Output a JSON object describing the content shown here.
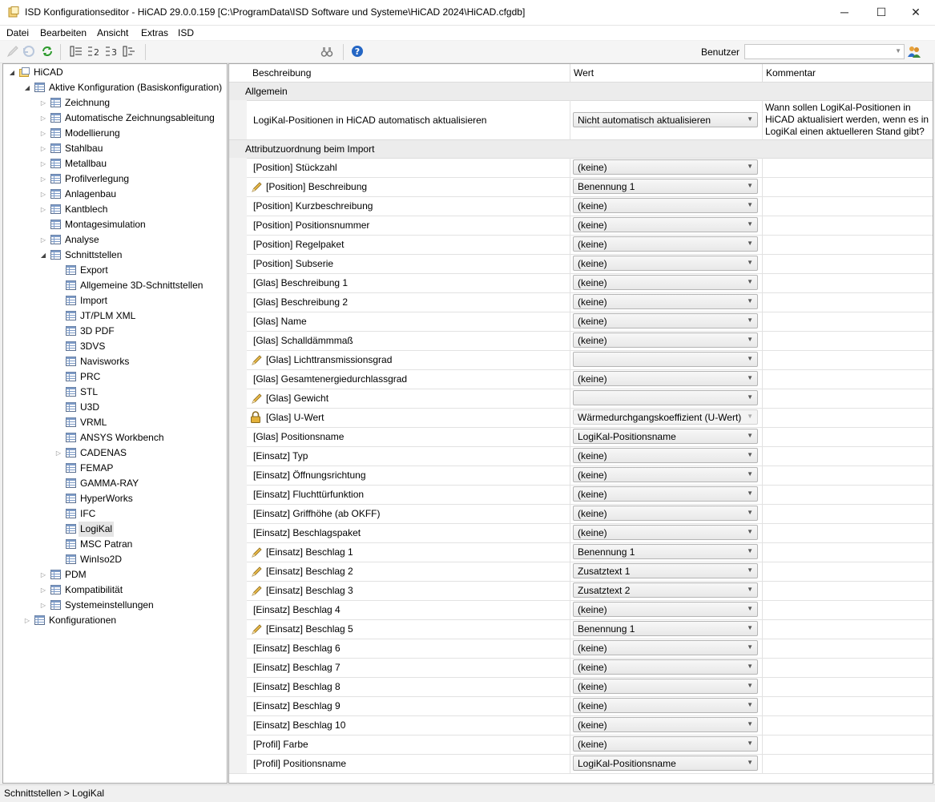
{
  "window": {
    "title": "ISD Konfigurationseditor  -  HiCAD 29.0.0.159 [C:\\ProgramData\\ISD Software und Systeme\\HiCAD 2024\\HiCAD.cfgdb]",
    "minimize": "─",
    "maximize": "☐",
    "close": "✕"
  },
  "menu": [
    "Datei",
    "Bearbeiten",
    "Ansicht",
    "Extras",
    "ISD"
  ],
  "toolbar": {
    "user_label": "Benutzer",
    "user_value": ""
  },
  "tree": [
    {
      "label": "HiCAD",
      "level": 0,
      "expander": "open",
      "icon": "folder-icon"
    },
    {
      "label": "Aktive Konfiguration (Basiskonfiguration)",
      "level": 1,
      "expander": "open",
      "icon": "grid-icon"
    },
    {
      "label": "Zeichnung",
      "level": 2,
      "expander": "closed",
      "icon": "grid-icon"
    },
    {
      "label": "Automatische Zeichnungsableitung",
      "level": 2,
      "expander": "closed",
      "icon": "grid-icon"
    },
    {
      "label": "Modellierung",
      "level": 2,
      "expander": "closed",
      "icon": "grid-icon"
    },
    {
      "label": "Stahlbau",
      "level": 2,
      "expander": "closed",
      "icon": "grid-icon"
    },
    {
      "label": "Metallbau",
      "level": 2,
      "expander": "closed",
      "icon": "grid-icon"
    },
    {
      "label": "Profilverlegung",
      "level": 2,
      "expander": "closed",
      "icon": "grid-icon"
    },
    {
      "label": "Anlagenbau",
      "level": 2,
      "expander": "closed",
      "icon": "grid-icon"
    },
    {
      "label": "Kantblech",
      "level": 2,
      "expander": "closed",
      "icon": "grid-icon"
    },
    {
      "label": "Montagesimulation",
      "level": 2,
      "expander": "none",
      "icon": "grid-icon"
    },
    {
      "label": "Analyse",
      "level": 2,
      "expander": "closed",
      "icon": "grid-icon"
    },
    {
      "label": "Schnittstellen",
      "level": 2,
      "expander": "open",
      "icon": "grid-icon"
    },
    {
      "label": "Export",
      "level": 3,
      "expander": "none",
      "icon": "grid-icon"
    },
    {
      "label": "Allgemeine 3D-Schnittstellen",
      "level": 3,
      "expander": "none",
      "icon": "grid-icon"
    },
    {
      "label": "Import",
      "level": 3,
      "expander": "none",
      "icon": "grid-icon"
    },
    {
      "label": "JT/PLM XML",
      "level": 3,
      "expander": "none",
      "icon": "grid-icon"
    },
    {
      "label": "3D PDF",
      "level": 3,
      "expander": "none",
      "icon": "grid-icon"
    },
    {
      "label": "3DVS",
      "level": 3,
      "expander": "none",
      "icon": "grid-icon"
    },
    {
      "label": "Navisworks",
      "level": 3,
      "expander": "none",
      "icon": "grid-icon"
    },
    {
      "label": "PRC",
      "level": 3,
      "expander": "none",
      "icon": "grid-icon"
    },
    {
      "label": "STL",
      "level": 3,
      "expander": "none",
      "icon": "grid-icon"
    },
    {
      "label": "U3D",
      "level": 3,
      "expander": "none",
      "icon": "grid-icon"
    },
    {
      "label": "VRML",
      "level": 3,
      "expander": "none",
      "icon": "grid-icon"
    },
    {
      "label": "ANSYS Workbench",
      "level": 3,
      "expander": "none",
      "icon": "grid-icon"
    },
    {
      "label": "CADENAS",
      "level": 3,
      "expander": "closed",
      "icon": "grid-icon"
    },
    {
      "label": "FEMAP",
      "level": 3,
      "expander": "none",
      "icon": "grid-icon"
    },
    {
      "label": "GAMMA-RAY",
      "level": 3,
      "expander": "none",
      "icon": "grid-icon"
    },
    {
      "label": "HyperWorks",
      "level": 3,
      "expander": "none",
      "icon": "grid-icon"
    },
    {
      "label": "IFC",
      "level": 3,
      "expander": "none",
      "icon": "grid-icon"
    },
    {
      "label": "LogiKal",
      "level": 3,
      "expander": "none",
      "icon": "grid-icon",
      "selected": true
    },
    {
      "label": "MSC Patran",
      "level": 3,
      "expander": "none",
      "icon": "grid-icon"
    },
    {
      "label": "WinIso2D",
      "level": 3,
      "expander": "none",
      "icon": "grid-icon"
    },
    {
      "label": "PDM",
      "level": 2,
      "expander": "closed",
      "icon": "grid-icon"
    },
    {
      "label": "Kompatibilität",
      "level": 2,
      "expander": "closed",
      "icon": "grid-icon"
    },
    {
      "label": "Systemeinstellungen",
      "level": 2,
      "expander": "closed",
      "icon": "grid-icon"
    },
    {
      "label": "Konfigurationen",
      "level": 1,
      "expander": "closed",
      "icon": "grid-icon"
    }
  ],
  "grid": {
    "headers": [
      "Beschreibung",
      "Wert",
      "Kommentar"
    ],
    "categories": [
      {
        "name": "Allgemein",
        "rows": [
          {
            "desc": "LogiKal-Positionen in HiCAD automatisch aktualisieren",
            "value": "Nicht automatisch aktualisieren",
            "comment": [
              "Wann sollen LogiKal-Positionen in",
              "HiCAD aktualisiert werden, wenn es in",
              "LogiKal einen aktuelleren Stand gibt?"
            ]
          }
        ]
      },
      {
        "name": "Attributzuordnung beim Import",
        "rows": [
          {
            "desc": "[Position] Stückzahl",
            "value": "(keine)"
          },
          {
            "desc": "[Position] Beschreibung",
            "value": "Benennung 1",
            "mark": "pencil"
          },
          {
            "desc": "[Position] Kurzbeschreibung",
            "value": "(keine)"
          },
          {
            "desc": "[Position] Positionsnummer",
            "value": "(keine)"
          },
          {
            "desc": "[Position] Regelpaket",
            "value": "(keine)"
          },
          {
            "desc": "[Position] Subserie",
            "value": "(keine)"
          },
          {
            "desc": "[Glas] Beschreibung 1",
            "value": "(keine)"
          },
          {
            "desc": "[Glas] Beschreibung 2",
            "value": "(keine)"
          },
          {
            "desc": "[Glas] Name",
            "value": "(keine)"
          },
          {
            "desc": "[Glas] Schalldämmmaß",
            "value": "(keine)"
          },
          {
            "desc": "[Glas] Lichttransmissionsgrad",
            "value": "",
            "mark": "pencil"
          },
          {
            "desc": "[Glas] Gesamtenergiedurchlassgrad",
            "value": "(keine)"
          },
          {
            "desc": "[Glas] Gewicht",
            "value": "",
            "mark": "pencil"
          },
          {
            "desc": "[Glas] U-Wert",
            "value": "Wärmedurchgangskoeffizient (U-Wert)",
            "mark": "lock",
            "disabled": true
          },
          {
            "desc": "[Glas] Positionsname",
            "value": "LogiKal-Positionsname"
          },
          {
            "desc": "[Einsatz] Typ",
            "value": "(keine)"
          },
          {
            "desc": "[Einsatz] Öffnungsrichtung",
            "value": "(keine)"
          },
          {
            "desc": "[Einsatz] Fluchttürfunktion",
            "value": "(keine)"
          },
          {
            "desc": "[Einsatz] Griffhöhe (ab OKFF)",
            "value": "(keine)"
          },
          {
            "desc": "[Einsatz] Beschlagspaket",
            "value": "(keine)"
          },
          {
            "desc": "[Einsatz] Beschlag 1",
            "value": "Benennung 1",
            "mark": "pencil"
          },
          {
            "desc": "[Einsatz] Beschlag 2",
            "value": "Zusatztext 1",
            "mark": "pencil"
          },
          {
            "desc": "[Einsatz] Beschlag 3",
            "value": "Zusatztext 2",
            "mark": "pencil"
          },
          {
            "desc": "[Einsatz] Beschlag 4",
            "value": "(keine)"
          },
          {
            "desc": "[Einsatz] Beschlag 5",
            "value": "Benennung 1",
            "mark": "pencil"
          },
          {
            "desc": "[Einsatz] Beschlag 6",
            "value": "(keine)"
          },
          {
            "desc": "[Einsatz] Beschlag 7",
            "value": "(keine)"
          },
          {
            "desc": "[Einsatz] Beschlag 8",
            "value": "(keine)"
          },
          {
            "desc": "[Einsatz] Beschlag 9",
            "value": "(keine)"
          },
          {
            "desc": "[Einsatz] Beschlag 10",
            "value": "(keine)"
          },
          {
            "desc": "[Profil] Farbe",
            "value": "(keine)"
          },
          {
            "desc": "[Profil] Positionsname",
            "value": "LogiKal-Positionsname"
          }
        ]
      }
    ]
  },
  "status": "Schnittstellen > LogiKal"
}
